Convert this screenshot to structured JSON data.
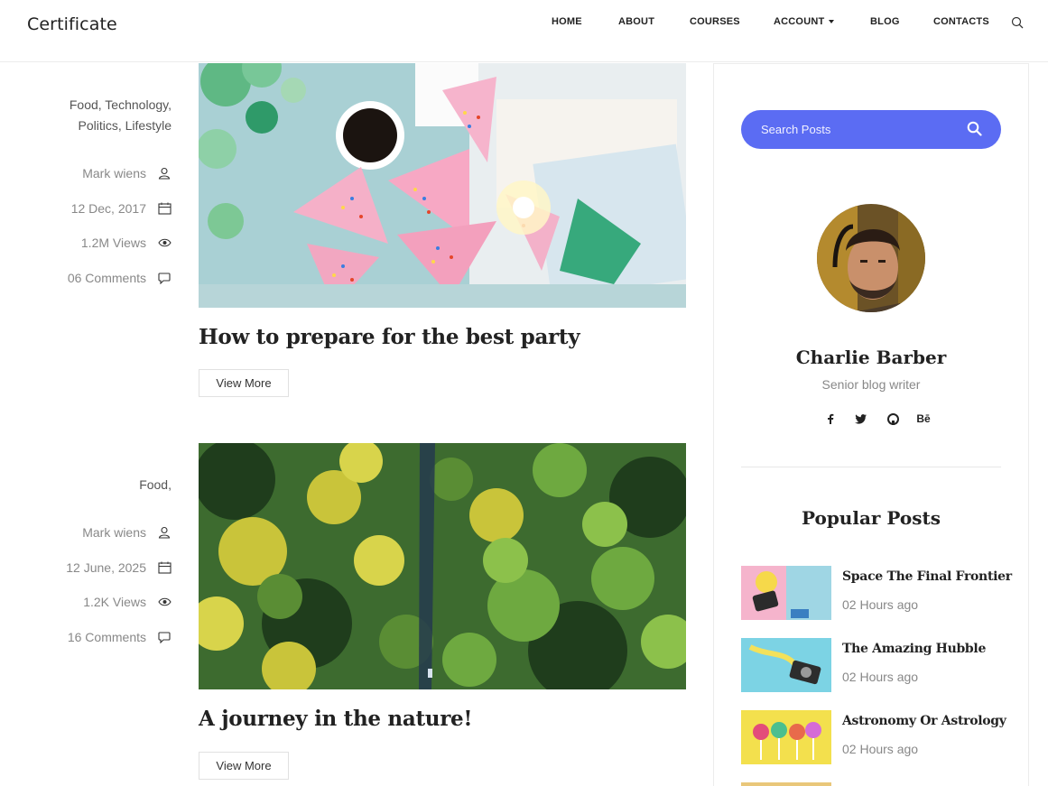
{
  "navbar": {
    "brand": "Certificate",
    "items": [
      {
        "label": "HOME"
      },
      {
        "label": "ABOUT"
      },
      {
        "label": "COURSES"
      },
      {
        "label": "ACCOUNT"
      },
      {
        "label": "BLOG"
      },
      {
        "label": "CONTACTS"
      }
    ],
    "search_icon": "search-icon"
  },
  "posts": [
    {
      "categories": "Food, Technology,",
      "categories_2": "Politics, Lifestyle",
      "author": "Mark wiens",
      "date": "12 Dec, 2017",
      "views": "1.2M Views",
      "comments": "06 Comments",
      "title": "How to prepare for the best party",
      "button": "View More"
    },
    {
      "categories": "Food,",
      "author": "Mark wiens",
      "date": "12 June, 2025",
      "views": "1.2K Views",
      "comments": "16 Comments",
      "title": "A journey in the nature!",
      "button": "View More"
    }
  ],
  "sidebar": {
    "search_placeholder": "Search Posts",
    "author_name": "Charlie Barber",
    "author_role": "Senior blog writer",
    "socials": [
      "facebook-icon",
      "twitter-icon",
      "github-icon",
      "behance-icon"
    ],
    "behance_label": "Bē",
    "popular_title": "Popular Posts",
    "popular_posts": [
      {
        "title": "Space The Final Frontier",
        "time": "02 Hours ago"
      },
      {
        "title": "The Amazing Hubble",
        "time": "02 Hours ago"
      },
      {
        "title": "Astronomy Or Astrology",
        "time": "02 Hours ago"
      }
    ]
  },
  "colors": {
    "accent": "#5b6cf3",
    "text_dark": "#222222",
    "text_muted": "#888888"
  }
}
